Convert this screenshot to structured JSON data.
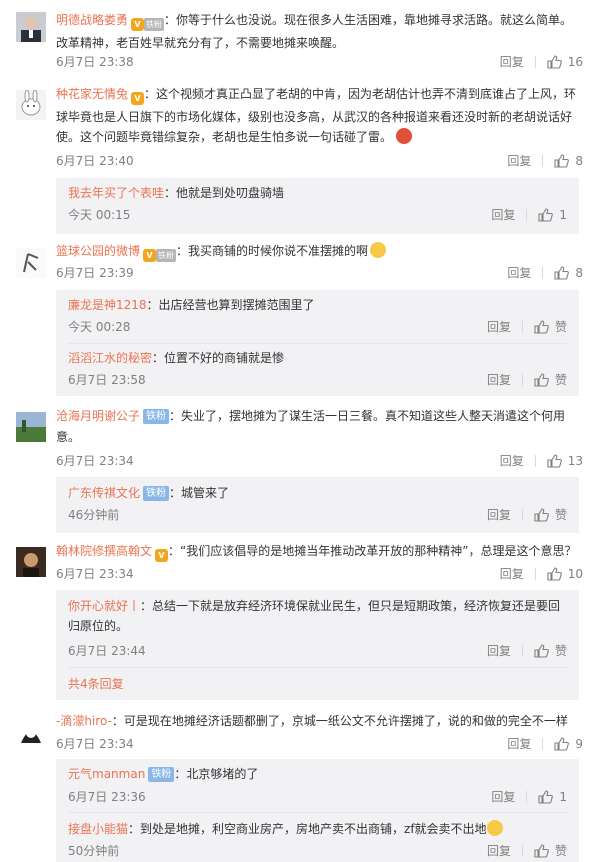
{
  "actions": {
    "reply_label": "回复",
    "like_label": "赞"
  },
  "comments": [
    {
      "user": "明德战略娄勇",
      "badge": "vip-fan",
      "text": "：你等于什么也没说。现在很多人生活困难，靠地摊寻求活路。就这么简单。改革精神，老百姓早就充分有了，不需要地摊来唤醒。",
      "time": "6月7日 23:38",
      "likes": "16"
    },
    {
      "user": "种花家无情兔",
      "badge": "vip",
      "text": "：这个视频才真正凸显了老胡的中肯，因为老胡估计也弄不清到底谁占了上风，环球毕竟也是人日旗下的市场化媒体，级别也没多高，从武汉的各种报道来看还没时新的老胡说话好使。这个问题毕竟错综复杂，老胡也是生怕多说一句话碰了雷。",
      "time": "6月7日 23:40",
      "likes": "8",
      "replies": [
        {
          "user": "我去年买了个表哇",
          "text": "：他就是到处叨盘骑墙",
          "time": "今天 00:15",
          "likes": "1"
        }
      ]
    },
    {
      "user": "篮球公园的微博",
      "badge": "vip-fan",
      "text": "：我买商铺的时候你说不准摆摊的啊",
      "time": "6月7日 23:39",
      "likes": "8",
      "replies": [
        {
          "user": "廉龙是神1218",
          "text": "：出店经营也算到摆摊范围里了",
          "time": "今天 00:28",
          "likes": "赞"
        },
        {
          "user": "滔滔江水的秘密",
          "text": "：位置不好的商铺就是惨",
          "time": "6月7日 23:58",
          "likes": "赞"
        }
      ]
    },
    {
      "user": "沧海月明谢公子",
      "badge": "tiefen",
      "badge_text": "铁粉",
      "text": "：失业了，摆地摊为了谋生活一日三餐。真不知道这些人整天消遣这个何用意。",
      "time": "6月7日 23:34",
      "likes": "13",
      "replies": [
        {
          "user": "广东传祺文化",
          "badge_text": "铁粉",
          "text": "：城管来了",
          "time": "46分钟前",
          "likes": "赞"
        }
      ]
    },
    {
      "user": "翰林院修撰高翰文",
      "badge": "vip",
      "text": "：“我们应该倡导的是地摊当年推动改革开放的那种精神”，总理是这个意思？",
      "time": "6月7日 23:34",
      "likes": "10",
      "replies": [
        {
          "user": "你开心就好丨",
          "text": "：总结一下就是放弃经济环境保就业民生，但只是短期政策，经济恢复还是要回归原位的。",
          "time": "6月7日 23:44",
          "likes": "赞"
        }
      ],
      "more_replies": "共4条回复"
    },
    {
      "user": "-滴濛hiro-",
      "text": "：可是现在地摊经济话题都删了，京城一纸公文不允许摆摊了，说的和做的完全不一样",
      "time": "6月7日 23:34",
      "likes": "9",
      "replies": [
        {
          "user": "元气manman",
          "badge_text": "铁粉",
          "text": "：北京够堵的了",
          "time": "6月7日 23:36",
          "likes": "1"
        },
        {
          "user": "接盘小能猫",
          "text": "：到处是地摊，利空商业房产，房地产卖不出商铺，zf就会卖不出地",
          "time": "50分钟前",
          "likes": "赞"
        }
      ]
    }
  ]
}
